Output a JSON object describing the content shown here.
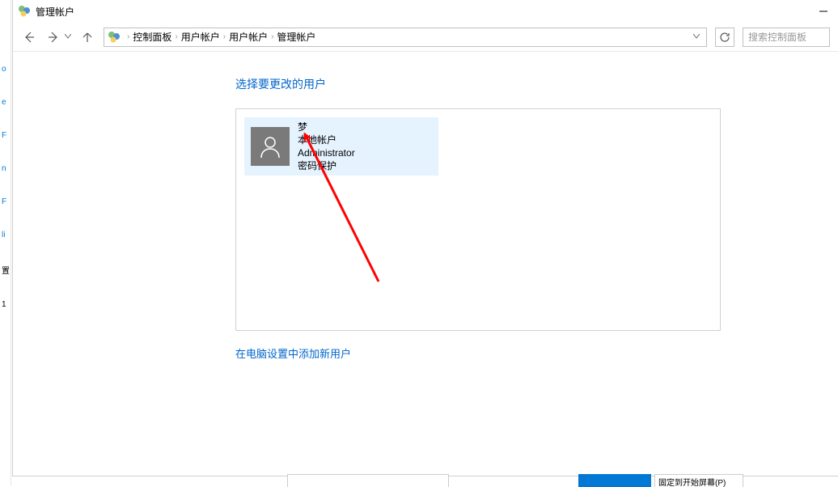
{
  "window": {
    "title": "管理帐户"
  },
  "breadcrumb": {
    "items": [
      "控制面板",
      "用户帐户",
      "用户帐户",
      "管理帐户"
    ]
  },
  "search": {
    "placeholder": "搜索控制面板"
  },
  "content": {
    "heading": "选择要更改的用户",
    "addUserLink": "在电脑设置中添加新用户"
  },
  "user": {
    "name": "梦",
    "accountType": "本地帐户",
    "role": "Administrator",
    "protection": "密码保护"
  },
  "leftEdge": {
    "items": [
      "o",
      "e",
      "F",
      "n",
      "F",
      "li",
      "置",
      "1"
    ]
  }
}
